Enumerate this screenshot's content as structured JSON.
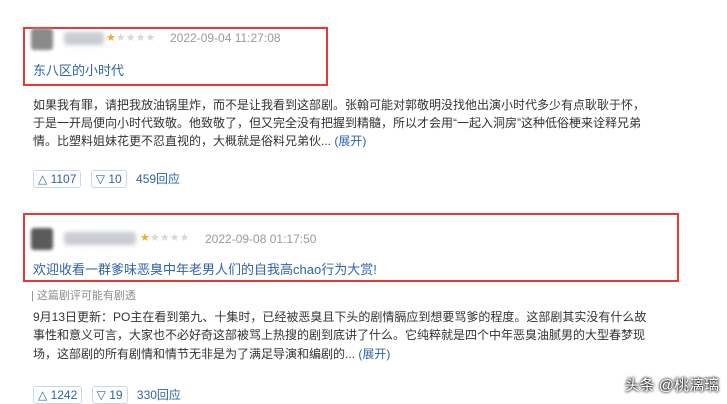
{
  "review1": {
    "date": "2022-09-04 11:27:08",
    "rating": 1,
    "rating_max": 5,
    "title": "东八区的小时代",
    "body_lines": [
      "如果我有罪，请把我放油锅里炸，而不是让我看到这部剧。张翰可能对郭敬明没找他出演小时代多少有点耿耿于怀，",
      "于是一开局便向小时代致敬。他致敬了，但又完全没有把握到精髓，所以才会用“一起入洞房”这种低俗梗来诠释兄弟",
      "情。比塑料姐妹花更不忍直视的，大概就是俗料兄弟伙..."
    ],
    "expand_label": "(展开)",
    "upvotes": "1107",
    "downvotes": "10",
    "replies": "459回应"
  },
  "review2": {
    "date": "2022-09-08 01:17:50",
    "rating": 1,
    "rating_max": 5,
    "title": "欢迎收看一群爹味恶臭中年老男人们的自我高chao行为大赏!",
    "spoiler_note": "| 这篇剧评可能有剧透",
    "body_lines": [
      "9月13日更新：PO主在看到第九、十集时，已经被恶臭且下头的剧情膈应到想要骂爹的程度。这部剧其实没有什么故",
      "事性和意义可言，大家也不必好奇这部被骂上热搜的剧到底讲了什么。它纯粹就是四个中年恶臭油腻男的大型春梦现",
      "场，这部剧的所有剧情和情节无非是为了满足导演和编剧的..."
    ],
    "expand_label": "(展开)",
    "upvotes": "1242",
    "downvotes": "19",
    "replies": "330回应"
  },
  "icons": {
    "upvote": "triangle-up",
    "downvote": "triangle-down",
    "star": "star"
  },
  "watermark": "头条 @桃漓璃",
  "colors": {
    "highlight": "#e53935",
    "link": "#2c64a8",
    "star_on": "#f5a623",
    "star_off": "#d8d8d8",
    "muted": "#9a9a9a"
  }
}
